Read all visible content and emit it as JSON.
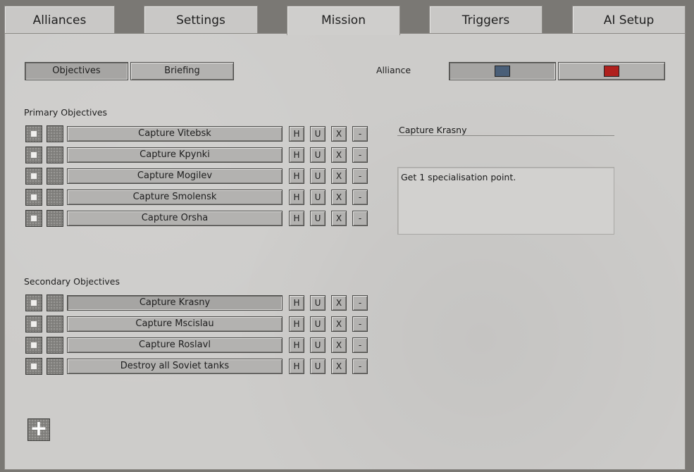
{
  "tabs": [
    {
      "label": "Alliances",
      "active": false
    },
    {
      "label": "Settings",
      "active": false
    },
    {
      "label": "Mission",
      "active": true
    },
    {
      "label": "Triggers",
      "active": false
    },
    {
      "label": "AI Setup",
      "active": false
    }
  ],
  "subtabs": {
    "objectives": "Objectives",
    "briefing": "Briefing",
    "selected": "objectives"
  },
  "alliance": {
    "label": "Alliance",
    "options": [
      {
        "color": "#4a5f78",
        "selected": true
      },
      {
        "color": "#b0211e",
        "selected": false
      }
    ]
  },
  "primary": {
    "heading": "Primary Objectives",
    "rows": [
      {
        "name": "Capture Vitebsk"
      },
      {
        "name": "Capture Kpynki"
      },
      {
        "name": "Capture Mogilev"
      },
      {
        "name": "Capture Smolensk"
      },
      {
        "name": "Capture Orsha"
      }
    ]
  },
  "secondary": {
    "heading": "Secondary Objectives",
    "rows": [
      {
        "name": "Capture Krasny",
        "selected": true
      },
      {
        "name": "Capture Mscislau"
      },
      {
        "name": "Capture Roslavl"
      },
      {
        "name": "Destroy all Soviet tanks"
      }
    ]
  },
  "row_buttons": {
    "h": "H",
    "u": "U",
    "x": "X",
    "minus": "-"
  },
  "detail": {
    "title": "Capture Krasny",
    "description": "Get 1 specialisation point."
  },
  "add_icon": "plus-icon",
  "add_glyph": "+"
}
